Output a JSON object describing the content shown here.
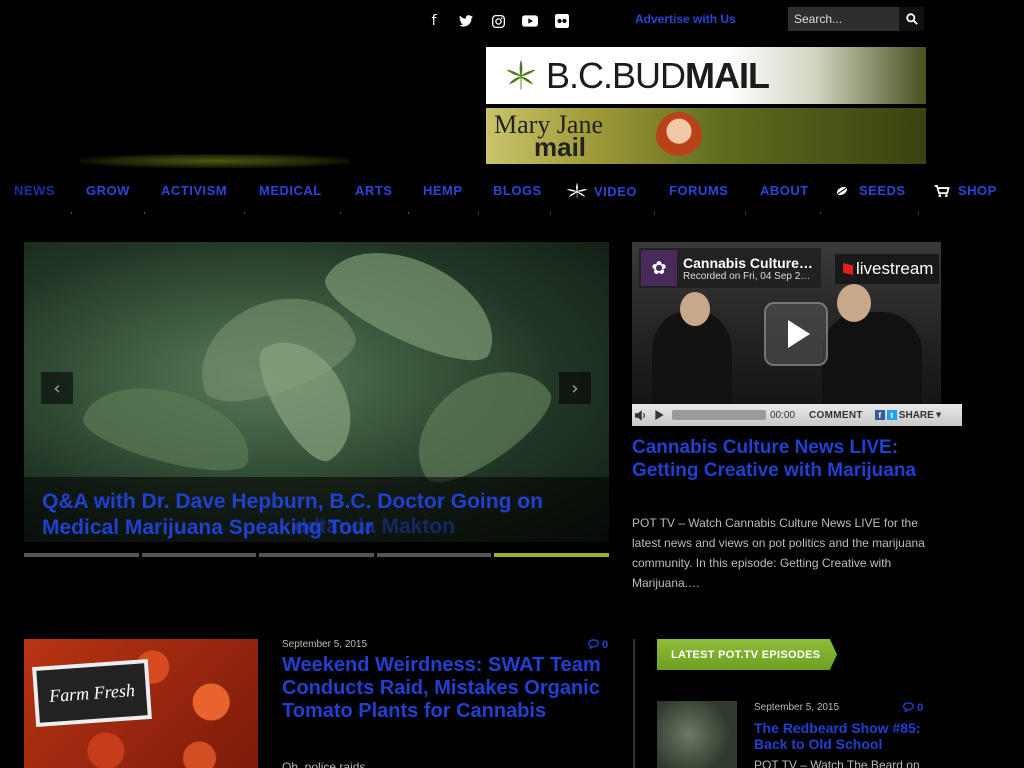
{
  "topbar": {
    "social_icons": [
      "facebook-icon",
      "twitter-icon",
      "instagram-icon",
      "youtube-icon",
      "flickr-icon"
    ],
    "advertise_label": "Advertise with Us",
    "search_placeholder": "Search..."
  },
  "banners": {
    "bcbud": {
      "prefix": "B.C.BUD",
      "suffix": "MAIL"
    },
    "maryjane": {
      "line1": "Mary Jane",
      "line2": "mail"
    }
  },
  "nav": {
    "items": [
      {
        "label": "NEWS",
        "icon": ""
      },
      {
        "label": "GROW",
        "icon": ""
      },
      {
        "label": "ACTIVISM",
        "icon": ""
      },
      {
        "label": "MEDICAL",
        "icon": ""
      },
      {
        "label": "ARTS",
        "icon": ""
      },
      {
        "label": "HEMP",
        "icon": ""
      },
      {
        "label": "BLOGS",
        "icon": ""
      },
      {
        "label": "VIDEO",
        "icon": "cannabis-leaf-icon"
      },
      {
        "label": "FORUMS",
        "icon": ""
      },
      {
        "label": "ABOUT",
        "icon": ""
      },
      {
        "label": "SEEDS",
        "icon": "seed-icon"
      },
      {
        "label": "SHOP",
        "icon": "cart-icon"
      }
    ]
  },
  "slider": {
    "title": "Q&A with Dr. Dave Hepburn, B.C. Doctor Going on Medical Marijuana Speaking Tour",
    "ghost_text": "ddtanda Makton",
    "prev_label": "‹",
    "next_label": "›",
    "active_index": 4,
    "slide_count": 5
  },
  "video": {
    "channel_title": "Cannabis Culture…",
    "recorded": "Recorded on Fri, 04 Sep 2…",
    "livestream_label": "livestream",
    "time": "00:00",
    "comment_label": "COMMENT",
    "share_label": "SHARE"
  },
  "feature": {
    "title": "Cannabis Culture News LIVE: Getting Creative with Marijuana",
    "excerpt": "POT TV – Watch Cannabis Culture News LIVE for the latest news and views on pot politics and the marijuana community. In this episode: Getting Creative with Marijuana.…"
  },
  "article": {
    "date": "September 5, 2015",
    "comments": "0",
    "title": "Weekend Weirdness: SWAT Team Conducts Raid, Mistakes Organic Tomato Plants for Cannabis",
    "excerpt": "Oh, police raids...",
    "image_sign": "Farm Fresh"
  },
  "sidebar": {
    "heading": "LATEST POT.TV EPISODES",
    "items": [
      {
        "date": "September 5, 2015",
        "comments": "0",
        "title": "The Redbeard Show #85: Back to Old School",
        "excerpt": "POT TV – Watch The Beard on"
      }
    ]
  },
  "colors": {
    "link_blue": "#2040d0",
    "accent_green": "#8fbe3a",
    "background": "#000000"
  }
}
